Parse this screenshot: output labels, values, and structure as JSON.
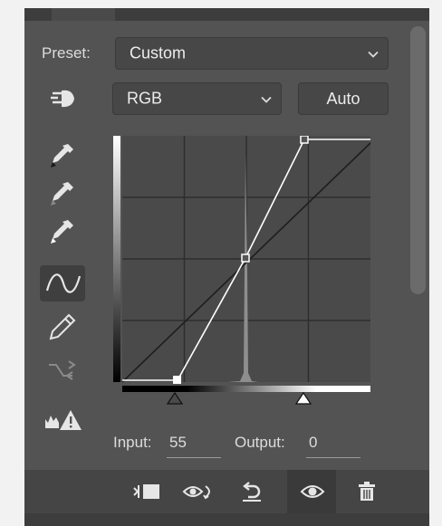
{
  "preset": {
    "label": "Preset:",
    "value": "Custom"
  },
  "channel": {
    "value": "RGB"
  },
  "auto_button": {
    "label": "Auto"
  },
  "input": {
    "label": "Input:",
    "value": "55"
  },
  "output": {
    "label": "Output:",
    "value": "0"
  },
  "tools": [
    "on-image-adjust-icon",
    "black-point-eyedropper-icon",
    "gray-point-eyedropper-icon",
    "white-point-eyedropper-icon",
    "curve-edit-points-icon",
    "pencil-draw-icon",
    "smooth-curve-icon",
    "clipping-warning-icon"
  ],
  "bottom_bar": [
    "clip-to-layer-icon",
    "view-previous-state-icon",
    "reset-icon",
    "visibility-eye-icon",
    "delete-trash-icon"
  ],
  "colors": {
    "panel": "#535353",
    "graph_bg": "#4a4a4a",
    "curve": "#ffffff"
  }
}
